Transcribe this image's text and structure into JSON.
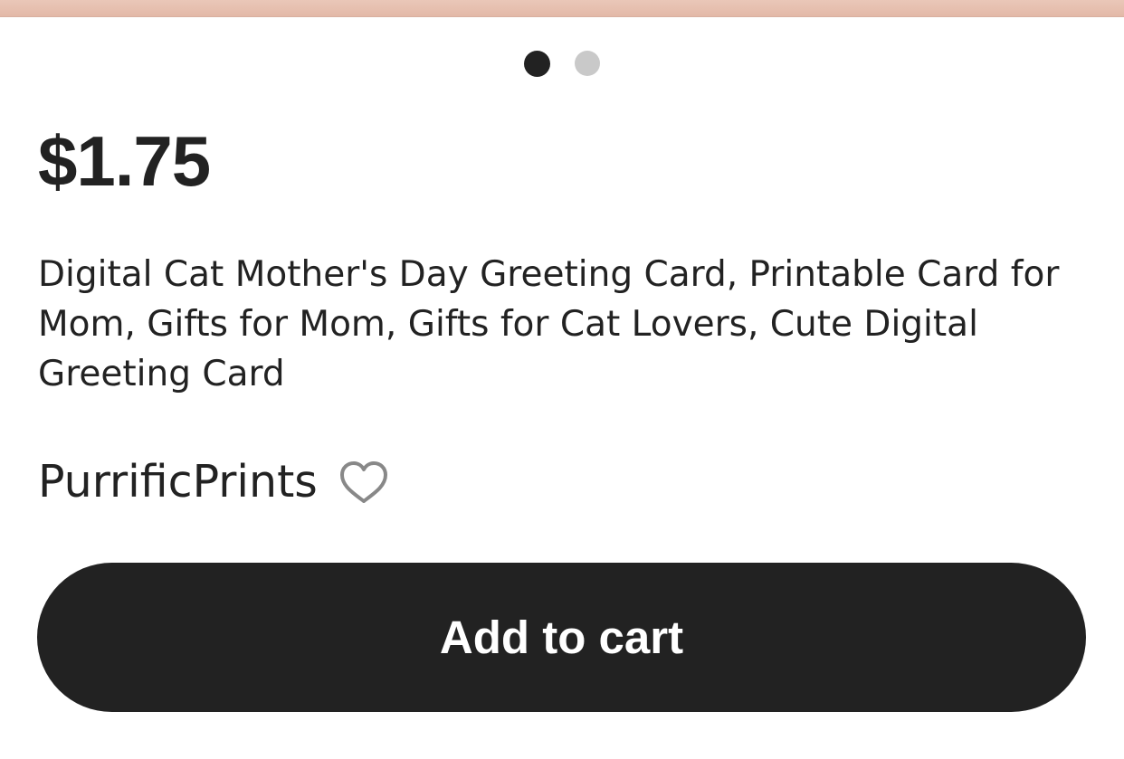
{
  "product": {
    "price": "$1.75",
    "title": "Digital Cat Mother's Day Greeting Card, Printable Card for Mom, Gifts for Mom, Gifts for Cat Lovers, Cute Digital Greeting Card",
    "shop_name": "PurrificPrints",
    "favorite_icon": "heart-outline-icon"
  },
  "carousel": {
    "total_pages": 2,
    "current_page": 1
  },
  "actions": {
    "add_to_cart_label": "Add to cart"
  },
  "colors": {
    "primary": "#222222",
    "background": "#ffffff",
    "dot_inactive": "#c9c9c9",
    "image_peach": "#e7c1b2"
  }
}
